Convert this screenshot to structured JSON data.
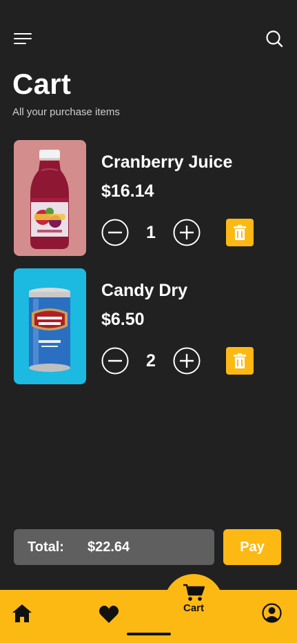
{
  "header": {
    "menu_icon": "menu-icon",
    "search_icon": "search-icon",
    "title": "Cart",
    "subtitle": "All your purchase items"
  },
  "cart": {
    "items": [
      {
        "name": "Cranberry Juice",
        "price": "$16.14",
        "quantity": "1",
        "image": "cranberry-juice-bottle",
        "image_bg": "#d48d8d"
      },
      {
        "name": "Candy Dry",
        "price": "$6.50",
        "quantity": "2",
        "image": "canada-dry-can",
        "image_bg": "#1cb9e0"
      }
    ],
    "total_label": "Total:",
    "total_value": "$22.64",
    "pay_label": "Pay"
  },
  "bottom_nav": {
    "cart_label": "Cart",
    "items": [
      "home-icon",
      "heart-icon",
      "cart-icon",
      "profile-icon"
    ]
  },
  "colors": {
    "background": "#212121",
    "accent": "#fdb913",
    "total_box": "#5f5f5f",
    "text": "#ffffff"
  }
}
